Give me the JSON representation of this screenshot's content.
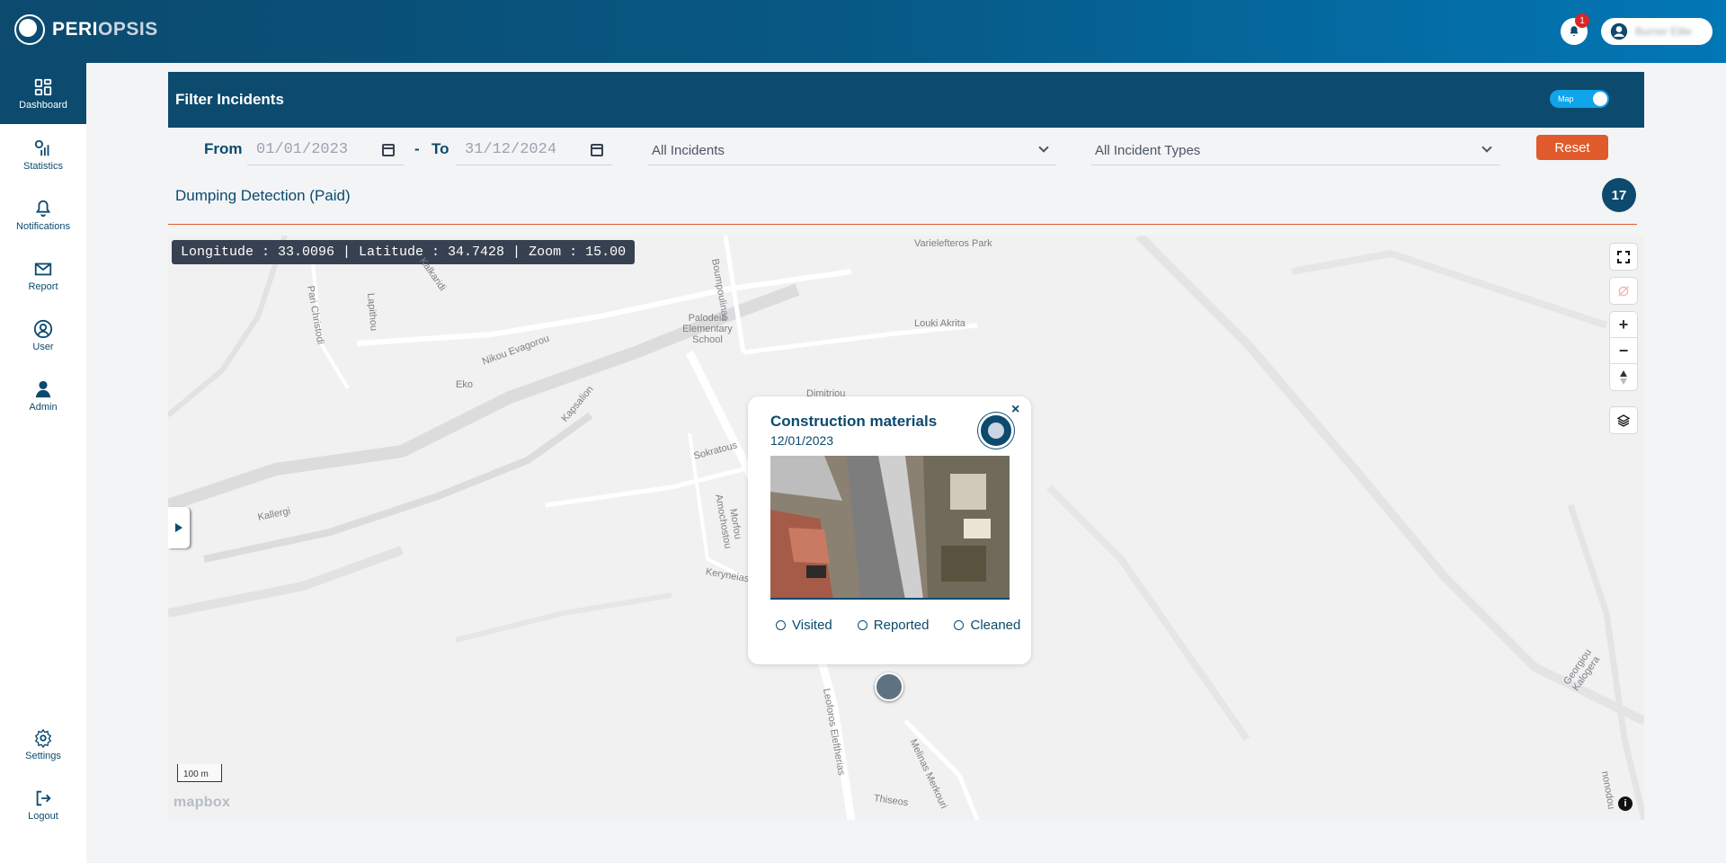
{
  "brand": {
    "part1": "PERI",
    "part2": "OPSIS"
  },
  "header": {
    "notification_count": "1",
    "user_name": "Burner Elite"
  },
  "sidebar": {
    "items": [
      {
        "label": "Dashboard",
        "icon": "dashboard-icon",
        "active": true
      },
      {
        "label": "Statistics",
        "icon": "statistics-icon"
      },
      {
        "label": "Notifications",
        "icon": "bell-icon"
      },
      {
        "label": "Report",
        "icon": "mail-icon"
      },
      {
        "label": "User",
        "icon": "user-icon"
      },
      {
        "label": "Admin",
        "icon": "admin-icon"
      }
    ],
    "bottom": [
      {
        "label": "Settings",
        "icon": "gear-icon"
      },
      {
        "label": "Logout",
        "icon": "logout-icon"
      }
    ]
  },
  "filter": {
    "title": "Filter Incidents",
    "toggle_label": "Map",
    "from_label": "From",
    "from_value": "01/01/2023",
    "to_label": "To",
    "dash": "-",
    "to_value": "31/12/2024",
    "incidents_select": "All Incidents",
    "types_select": "All Incident Types",
    "reset_label": "Reset"
  },
  "detection": {
    "title": "Dumping Detection (Paid)",
    "count": "17"
  },
  "map": {
    "coord_text": "Longitude : 33.0096 | Latitude : 34.7428 | Zoom : 15.00",
    "scale_label": "100 m",
    "attribution": "mapbox",
    "labels": {
      "varielefteros": "Varielefteros Park",
      "boumpoulinas": "Boumpoulinas",
      "pari_christodi": "Pari Christodi",
      "lapithou": "Lapithou",
      "kalkaridi": "Kalkaridi",
      "palodeia": "Palodeia Elementary School",
      "louki": "Louki Akrita",
      "nikou": "Nikou Evagorou",
      "eko": "Eko",
      "kapsalion": "Kapsalion",
      "dimitriou": "Dimitriou",
      "sokratous": "Sokratous",
      "amochostou": "Amochostou",
      "morfou": "Morfou",
      "kallergi": "Kallergi",
      "keryneias": "Keryneias",
      "leoforos": "Leoforos Eleftherias",
      "melinas": "Melinas Merkouri",
      "thiseos": "Thiseos",
      "georgiou": "Georgiou Kalogera",
      "nonodou": "nonodou"
    }
  },
  "popup": {
    "title": "Construction materials",
    "date": "12/01/2023",
    "close": "×",
    "options": [
      "Visited",
      "Reported",
      "Cleaned"
    ]
  },
  "colors": {
    "primary": "#0c4a6e",
    "accent": "#e05a2b",
    "toggle": "#0ea5e9"
  }
}
